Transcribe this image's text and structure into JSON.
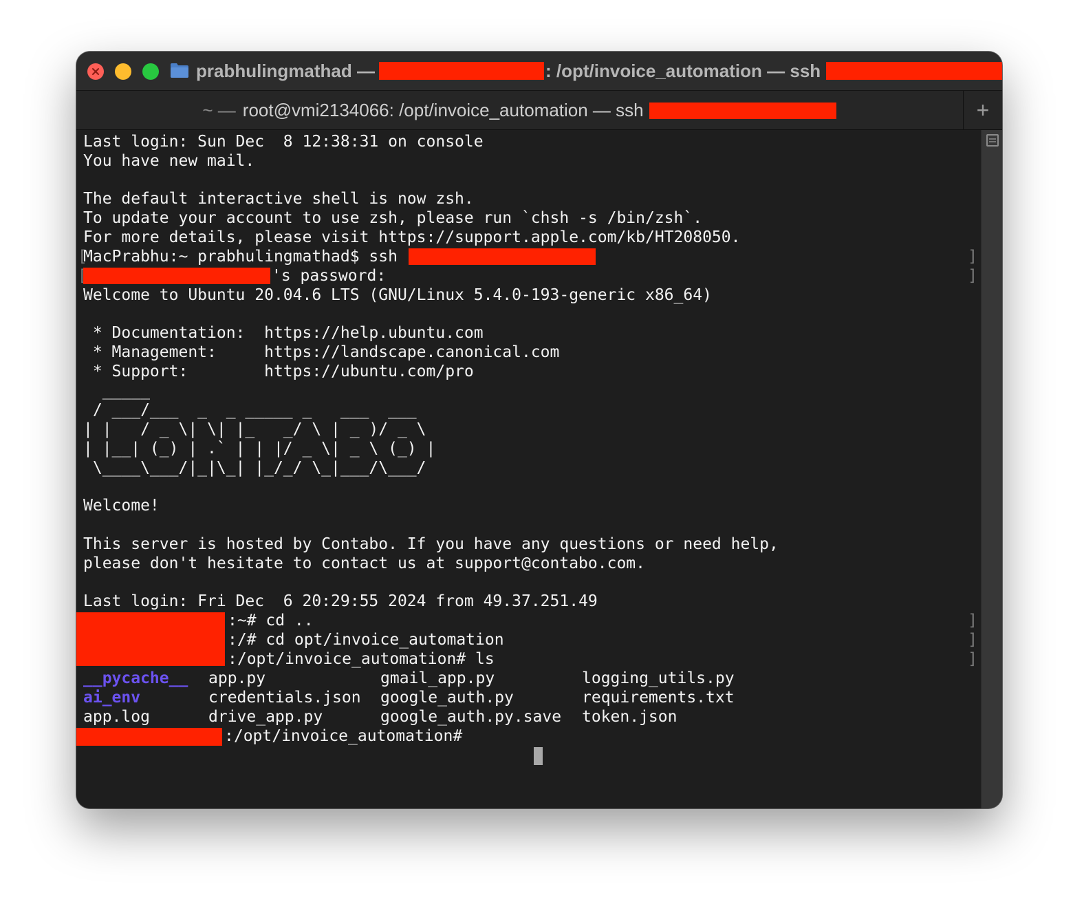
{
  "window": {
    "title_user": "prabhulingmathad —",
    "title_path": ": /opt/invoice_automation — ssh",
    "tab_prefix": "~ —",
    "tab_title": "root@vmi2134066: /opt/invoice_automation — ssh",
    "new_tab_label": "+"
  },
  "terminal": {
    "lines": [
      "Last login: Sun Dec  8 12:38:31 on console",
      "You have new mail.",
      "",
      "The default interactive shell is now zsh.",
      "To update your account to use zsh, please run `chsh -s /bin/zsh`.",
      "For more details, please visit https://support.apple.com/kb/HT208050.",
      "MacPrabhu:~ prabhulingmathad$ ssh",
      "'s password:",
      "Welcome to Ubuntu 20.04.6 LTS (GNU/Linux 5.4.0-193-generic x86_64)",
      "",
      " * Documentation:  https://help.ubuntu.com",
      " * Management:     https://landscape.canonical.com",
      " * Support:        https://ubuntu.com/pro",
      "  _____",
      " / ___/___  _  _ _____ _   ___  ___",
      "| |   / _ \\| \\| |_   _/ \\ | _ )/ _ \\",
      "| |__| (_) | .` | | |/ _ \\| _ \\ (_) |",
      " \\____\\___/|_|\\_| |_/_/ \\_|___/\\___/",
      "",
      "Welcome!",
      "",
      "This server is hosted by Contabo. If you have any questions or need help,",
      "please don't hesitate to contact us at support@contabo.com.",
      "",
      "Last login: Fri Dec  6 20:29:55 2024 from 49.37.251.49",
      ":~# cd ..",
      ":/# cd opt/invoice_automation",
      ":/opt/invoice_automation# ls"
    ],
    "ls_output": [
      [
        "__pycache__",
        "app.py",
        "gmail_app.py",
        "logging_utils.py"
      ],
      [
        "ai_env",
        "credentials.json",
        "google_auth.py",
        "requirements.txt"
      ],
      [
        "app.log",
        "drive_app.py",
        "google_auth.py.save",
        "token.json"
      ]
    ],
    "prompt": ":/opt/invoice_automation#",
    "colors": {
      "background": "#1e1e1e",
      "text": "#f2f2f2",
      "directory": "#6b52f0",
      "redaction": "#ff2200"
    }
  }
}
